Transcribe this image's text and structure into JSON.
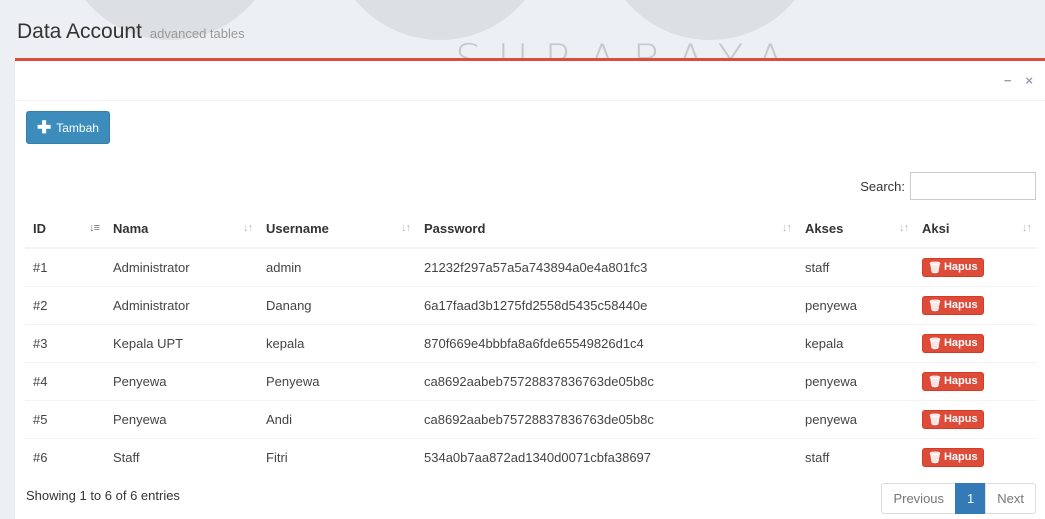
{
  "watermark": {
    "text": "SURABAYA"
  },
  "header": {
    "title": "Data Account",
    "subtitle": "advanced tables"
  },
  "box_tools": {
    "minimize": "−",
    "close": "×"
  },
  "toolbar": {
    "add_label": "Tambah",
    "add_icon": "plus-icon"
  },
  "search": {
    "label": "Search:",
    "value": "",
    "placeholder": ""
  },
  "table": {
    "columns": [
      "ID",
      "Nama",
      "Username",
      "Password",
      "Akses",
      "Aksi"
    ],
    "delete_label": "Hapus",
    "rows": [
      {
        "id": "#1",
        "nama": "Administrator",
        "username": "admin",
        "password": "21232f297a57a5a743894a0e4a801fc3",
        "akses": "staff"
      },
      {
        "id": "#2",
        "nama": "Administrator",
        "username": "Danang",
        "password": "6a17faad3b1275fd2558d5435c58440e",
        "akses": "penyewa"
      },
      {
        "id": "#3",
        "nama": "Kepala UPT",
        "username": "kepala",
        "password": "870f669e4bbbfa8a6fde65549826d1c4",
        "akses": "kepala"
      },
      {
        "id": "#4",
        "nama": "Penyewa",
        "username": "Penyewa",
        "password": "ca8692aabeb75728837836763de05b8c",
        "akses": "penyewa"
      },
      {
        "id": "#5",
        "nama": "Penyewa",
        "username": "Andi",
        "password": "ca8692aabeb75728837836763de05b8c",
        "akses": "penyewa"
      },
      {
        "id": "#6",
        "nama": "Staff",
        "username": "Fitri",
        "password": "534a0b7aa872ad1340d0071cbfa38697",
        "akses": "staff"
      }
    ]
  },
  "footer": {
    "info": "Showing 1 to 6 of 6 entries",
    "prev": "Previous",
    "page": "1",
    "next": "Next"
  },
  "colors": {
    "box_border": "#dd4b39",
    "primary": "#3c8dbc",
    "danger": "#dd4b39",
    "page_active": "#337ab7"
  }
}
